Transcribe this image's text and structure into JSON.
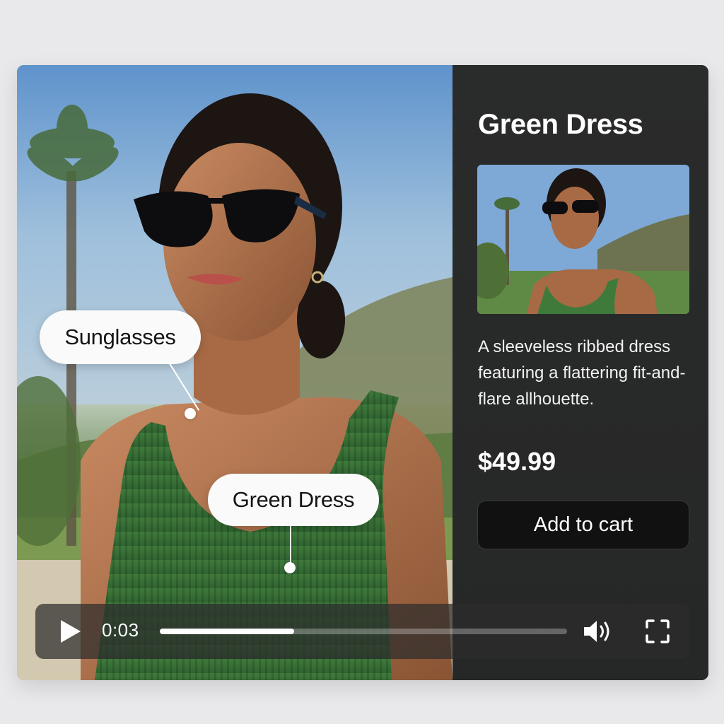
{
  "video": {
    "tags": {
      "sunglasses": "Sunglasses",
      "dress": "Green Dress"
    },
    "player": {
      "time": "0:03",
      "progress": 0.33
    }
  },
  "panel": {
    "title": "Green Dress",
    "description": "A sleeveless ribbed dress featuring a flattering fit-and-flare allhouette.",
    "price": "$49.99",
    "cart_label": "Add to cart"
  },
  "icons": {
    "play": "play-icon",
    "volume": "volume-icon",
    "fullscreen": "fullscreen-icon"
  },
  "colors": {
    "dress_green": "#3f7a3b",
    "panel_bg": "#2a2b2b",
    "button_bg": "#111111"
  }
}
